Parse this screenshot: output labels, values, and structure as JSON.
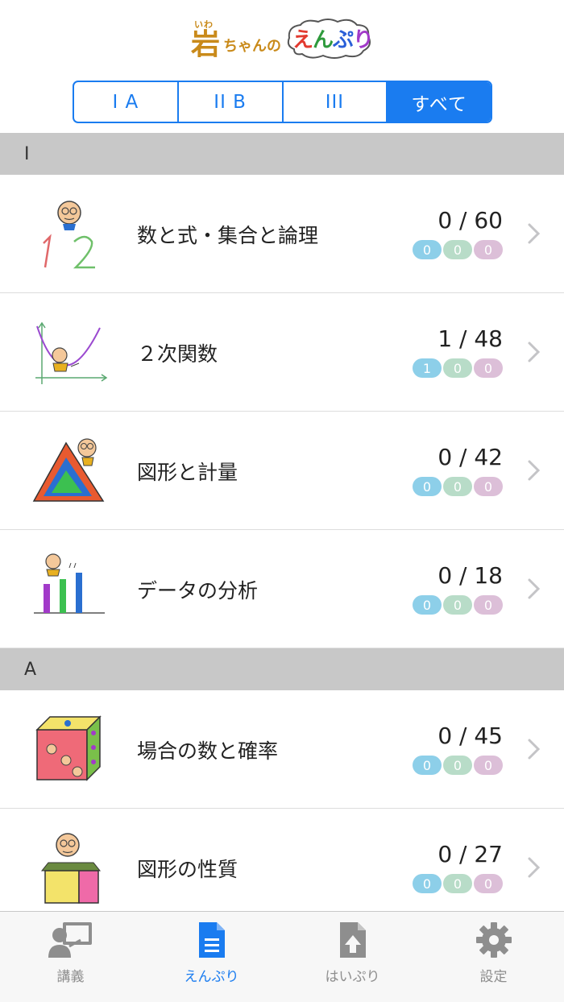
{
  "app": {
    "logo_kanji": "岩",
    "logo_ruby": "いわ",
    "logo_mid": "ちゃんの",
    "logo_app_parts": [
      "え",
      "ん",
      "ぷ",
      "り"
    ]
  },
  "segments": [
    {
      "label": "I A",
      "active": false
    },
    {
      "label": "II B",
      "active": false
    },
    {
      "label": "III",
      "active": false
    },
    {
      "label": "すべて",
      "active": true
    }
  ],
  "sections": [
    {
      "header": "I",
      "rows": [
        {
          "icon": "numbers-1-2-illustration-icon",
          "title": "数と式・集合と論理",
          "count": "0 / 60",
          "badges": [
            "0",
            "0",
            "0"
          ]
        },
        {
          "icon": "parabola-graph-illustration-icon",
          "title": "２次関数",
          "count": "1 / 48",
          "badges": [
            "1",
            "0",
            "0"
          ]
        },
        {
          "icon": "triangle-illustration-icon",
          "title": "図形と計量",
          "count": "0 / 42",
          "badges": [
            "0",
            "0",
            "0"
          ]
        },
        {
          "icon": "bar-data-illustration-icon",
          "title": "データの分析",
          "count": "0 / 18",
          "badges": [
            "0",
            "0",
            "0"
          ]
        }
      ]
    },
    {
      "header": "A",
      "rows": [
        {
          "icon": "dice-cube-illustration-icon",
          "title": "場合の数と確率",
          "count": "0 / 45",
          "badges": [
            "0",
            "0",
            "0"
          ]
        },
        {
          "icon": "geometry-box-illustration-icon",
          "title": "図形の性質",
          "count": "0 / 27",
          "badges": [
            "0",
            "0",
            "0"
          ]
        }
      ]
    }
  ],
  "tabs": [
    {
      "name": "lecture",
      "label": "講義",
      "icon": "lecture-icon",
      "active": false
    },
    {
      "name": "enpuri",
      "label": "えんぷり",
      "icon": "document-icon",
      "active": true
    },
    {
      "name": "haipuri",
      "label": "はいぷり",
      "icon": "upload-document-icon",
      "active": false
    },
    {
      "name": "settings",
      "label": "設定",
      "icon": "gear-icon",
      "active": false
    }
  ],
  "colors": {
    "accent": "#1a7cf0",
    "section_bg": "#c8c8c8",
    "badge_blue": "#8dcfe9",
    "badge_green": "#b8dcc8",
    "badge_pink": "#dcbfd8",
    "tab_inactive": "#8e8e8e"
  }
}
